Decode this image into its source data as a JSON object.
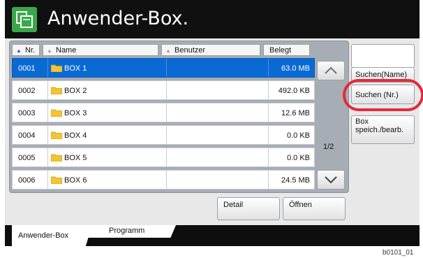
{
  "title": "Anwender-Box.",
  "columns": {
    "nr": "Nr.",
    "name": "Name",
    "benutzer": "Benutzer",
    "belegt": "Belegt"
  },
  "rows": [
    {
      "nr": "0001",
      "name": "BOX 1",
      "user": "",
      "belegt": "63.0  MB",
      "selected": true
    },
    {
      "nr": "0002",
      "name": "BOX 2",
      "user": "",
      "belegt": "492.0  KB",
      "selected": false
    },
    {
      "nr": "0003",
      "name": "BOX 3",
      "user": "",
      "belegt": "12.6  MB",
      "selected": false
    },
    {
      "nr": "0004",
      "name": "BOX 4",
      "user": "",
      "belegt": "0.0  KB",
      "selected": false
    },
    {
      "nr": "0005",
      "name": "BOX 5",
      "user": "",
      "belegt": "0.0  KB",
      "selected": false
    },
    {
      "nr": "0006",
      "name": "BOX 6",
      "user": "",
      "belegt": "24.5  MB",
      "selected": false
    }
  ],
  "page_indicator": "1/2",
  "side_buttons": {
    "search_name": "Suchen(Name)",
    "search_nr": "Suchen (Nr.)",
    "box_edit_line1": "Box",
    "box_edit_line2": "speich./bearb."
  },
  "bottom_buttons": {
    "detail": "Detail",
    "open": "Öffnen"
  },
  "tabs": {
    "active": "Anwender-Box",
    "other": "Programm"
  },
  "caption": "b0101_01",
  "colors": {
    "titlebar": "#101010",
    "selected_row": "#0a6ad4",
    "highlight_ring": "#e22b3a",
    "icon_green": "#3aa84a"
  }
}
